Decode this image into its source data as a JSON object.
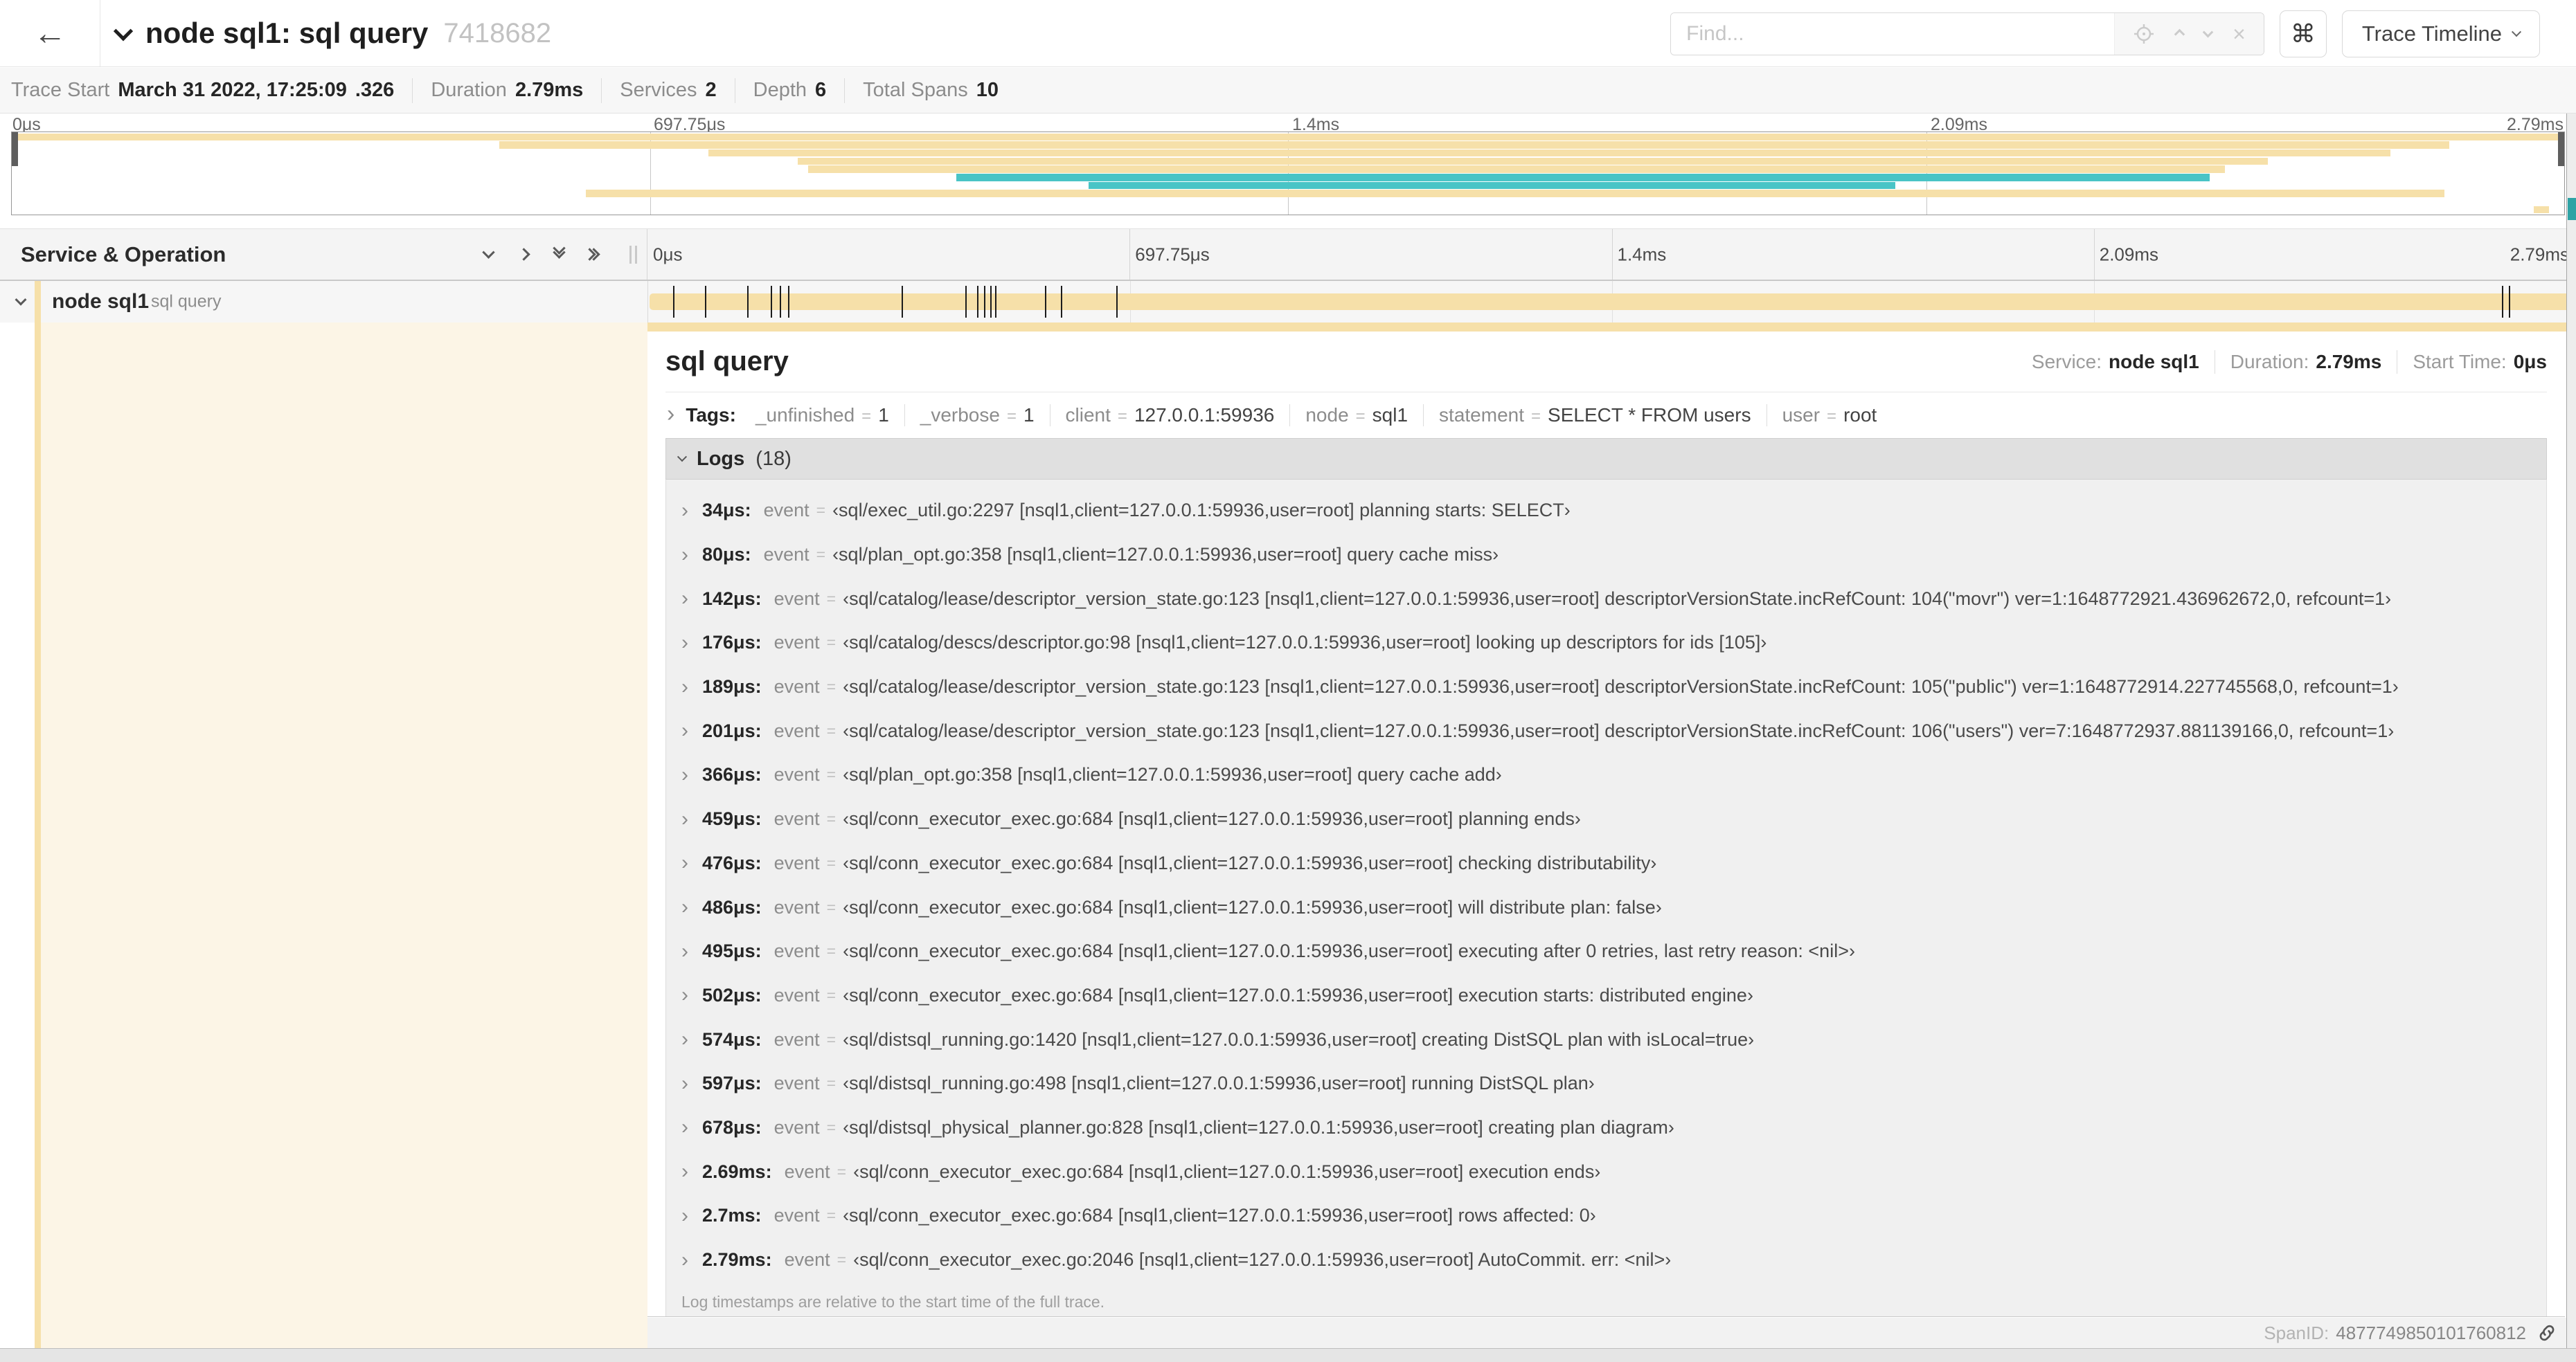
{
  "header": {
    "title": "node sql1: sql query",
    "trace_id": "7418682",
    "find_placeholder": "Find...",
    "view_selector": "Trace Timeline"
  },
  "trace_info": {
    "items": [
      {
        "label": "Trace Start",
        "value": "March 31 2022, 17:25:09",
        "suffix": ".326"
      },
      {
        "label": "Duration",
        "value": "2.79ms"
      },
      {
        "label": "Services",
        "value": "2"
      },
      {
        "label": "Depth",
        "value": "6"
      },
      {
        "label": "Total Spans",
        "value": "10"
      }
    ]
  },
  "timeline": {
    "duration_us": 2790,
    "ticks": [
      "0μs",
      "697.75μs",
      "1.4ms",
      "2.09ms",
      "2.79ms"
    ]
  },
  "minimap": {
    "rows": [
      {
        "row": 0,
        "start": 0,
        "end": 100,
        "color": "tan"
      },
      {
        "row": 1,
        "start": 19.1,
        "end": 95.5,
        "color": "tan"
      },
      {
        "row": 2,
        "start": 27.3,
        "end": 93.2,
        "color": "tan"
      },
      {
        "row": 3,
        "start": 30.8,
        "end": 88.4,
        "color": "tan"
      },
      {
        "row": 4,
        "start": 31.2,
        "end": 86.7,
        "color": "tan"
      },
      {
        "row": 5,
        "start": 37.0,
        "end": 86.1,
        "color": "teal"
      },
      {
        "row": 6,
        "start": 42.2,
        "end": 73.8,
        "color": "teal"
      },
      {
        "row": 7,
        "start": 22.5,
        "end": 95.3,
        "color": "tan"
      },
      {
        "row": 9,
        "start": 98.8,
        "end": 99.4,
        "color": "tan"
      }
    ]
  },
  "span_list": {
    "header": "Service & Operation",
    "row": {
      "service": "node sql1",
      "operation": "sql query"
    }
  },
  "detail": {
    "title": "sql query",
    "meta": [
      {
        "label": "Service:",
        "value": "node sql1"
      },
      {
        "label": "Duration:",
        "value": "2.79ms"
      },
      {
        "label": "Start Time:",
        "value": "0μs"
      }
    ],
    "tags_label": "Tags:",
    "tags": [
      {
        "key": "_unfinished",
        "value": "1"
      },
      {
        "key": "_verbose",
        "value": "1"
      },
      {
        "key": "client",
        "value": "127.0.0.1:59936"
      },
      {
        "key": "node",
        "value": "sql1"
      },
      {
        "key": "statement",
        "value": "SELECT * FROM users"
      },
      {
        "key": "user",
        "value": "root"
      }
    ],
    "logs_title": "Logs",
    "logs_count": "(18)",
    "log_key": "event",
    "logs": [
      {
        "us": 34,
        "t": "34μs:",
        "event": "‹sql/exec_util.go:2297 [nsql1,client=127.0.0.1:59936,user=root] planning starts: SELECT›"
      },
      {
        "us": 80,
        "t": "80μs:",
        "event": "‹sql/plan_opt.go:358 [nsql1,client=127.0.0.1:59936,user=root] query cache miss›"
      },
      {
        "us": 142,
        "t": "142μs:",
        "event": "‹sql/catalog/lease/descriptor_version_state.go:123 [nsql1,client=127.0.0.1:59936,user=root] descriptorVersionState.incRefCount: 104(\"movr\") ver=1:1648772921.436962672,0, refcount=1›"
      },
      {
        "us": 176,
        "t": "176μs:",
        "event": "‹sql/catalog/descs/descriptor.go:98 [nsql1,client=127.0.0.1:59936,user=root] looking up descriptors for ids [105]›"
      },
      {
        "us": 189,
        "t": "189μs:",
        "event": "‹sql/catalog/lease/descriptor_version_state.go:123 [nsql1,client=127.0.0.1:59936,user=root] descriptorVersionState.incRefCount: 105(\"public\") ver=1:1648772914.227745568,0, refcount=1›"
      },
      {
        "us": 201,
        "t": "201μs:",
        "event": "‹sql/catalog/lease/descriptor_version_state.go:123 [nsql1,client=127.0.0.1:59936,user=root] descriptorVersionState.incRefCount: 106(\"users\") ver=7:1648772937.881139166,0, refcount=1›"
      },
      {
        "us": 366,
        "t": "366μs:",
        "event": "‹sql/plan_opt.go:358 [nsql1,client=127.0.0.1:59936,user=root] query cache add›"
      },
      {
        "us": 459,
        "t": "459μs:",
        "event": "‹sql/conn_executor_exec.go:684 [nsql1,client=127.0.0.1:59936,user=root] planning ends›"
      },
      {
        "us": 476,
        "t": "476μs:",
        "event": "‹sql/conn_executor_exec.go:684 [nsql1,client=127.0.0.1:59936,user=root] checking distributability›"
      },
      {
        "us": 486,
        "t": "486μs:",
        "event": "‹sql/conn_executor_exec.go:684 [nsql1,client=127.0.0.1:59936,user=root] will distribute plan: false›"
      },
      {
        "us": 495,
        "t": "495μs:",
        "event": "‹sql/conn_executor_exec.go:684 [nsql1,client=127.0.0.1:59936,user=root] executing after 0 retries, last retry reason: <nil>›"
      },
      {
        "us": 502,
        "t": "502μs:",
        "event": "‹sql/conn_executor_exec.go:684 [nsql1,client=127.0.0.1:59936,user=root] execution starts: distributed engine›"
      },
      {
        "us": 574,
        "t": "574μs:",
        "event": "‹sql/distsql_running.go:1420 [nsql1,client=127.0.0.1:59936,user=root] creating DistSQL plan with isLocal=true›"
      },
      {
        "us": 597,
        "t": "597μs:",
        "event": "‹sql/distsql_running.go:498 [nsql1,client=127.0.0.1:59936,user=root] running DistSQL plan›"
      },
      {
        "us": 678,
        "t": "678μs:",
        "event": "‹sql/distsql_physical_planner.go:828 [nsql1,client=127.0.0.1:59936,user=root] creating plan diagram›"
      },
      {
        "us": 2690,
        "t": "2.69ms:",
        "event": "‹sql/conn_executor_exec.go:684 [nsql1,client=127.0.0.1:59936,user=root] execution ends›"
      },
      {
        "us": 2700,
        "t": "2.7ms:",
        "event": "‹sql/conn_executor_exec.go:684 [nsql1,client=127.0.0.1:59936,user=root] rows affected: 0›"
      },
      {
        "us": 2790,
        "t": "2.79ms:",
        "event": "‹sql/conn_executor_exec.go:2046 [nsql1,client=127.0.0.1:59936,user=root] AutoCommit. err: <nil>›"
      }
    ],
    "logs_note": "Log timestamps are relative to the start time of the full trace.",
    "spanid_label": "SpanID:",
    "spanid_value": "4877749850101760812"
  },
  "colors": {
    "tan": "#F6E0A9",
    "teal": "#49C4C6",
    "cream": "#FCF5E6"
  }
}
